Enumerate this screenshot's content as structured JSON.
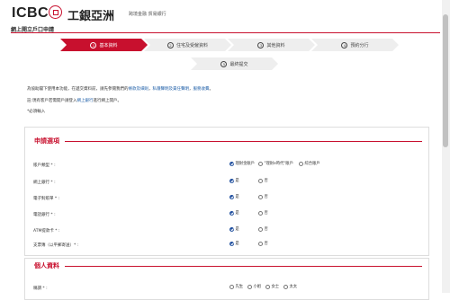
{
  "header": {
    "logo_en": "ICBC",
    "logo_cn": "工銀亞洲",
    "tagline": "跨境金融 貿易銀行"
  },
  "page_title": "網上開立戶口申請",
  "steps": [
    {
      "num": "1",
      "label": "基本資料",
      "state": "active"
    },
    {
      "num": "2",
      "label": "住宅及受僱資料",
      "state": "pending"
    },
    {
      "num": "3",
      "label": "其他資料",
      "state": "pending"
    },
    {
      "num": "4",
      "label": "預約分行",
      "state": "pending"
    },
    {
      "num": "5",
      "label": "最終提交",
      "state": "pending"
    }
  ],
  "intro": {
    "line1_prefix": "為協助閣下使用本功能，在遞交資料前，請先參閱我們的",
    "link_terms": "條款及細則",
    "sep1": "，",
    "link_privacy": "私隱聲明及責任聲明",
    "sep2": "，",
    "link_fees": "服務收費",
    "line1_suffix": "。",
    "line2_prefix": "註:現有客戶若需開戶請登入",
    "line2_link": "網上銀行",
    "line2_suffix": "進行網上開戶。",
    "required_note": "*必須輸入"
  },
  "application": {
    "section_title": "申請選項",
    "account_type": {
      "label": "賬戶類型 * :",
      "options": [
        {
          "label": "理財金賬戶",
          "selected": true
        },
        {
          "label": "\"理財e時代\"賬戶",
          "selected": false
        },
        {
          "label": "綜合賬戶",
          "selected": false
        }
      ]
    },
    "rows": [
      {
        "label": "網上銀行 * :",
        "yes": "是",
        "no": "否",
        "selected": "yes"
      },
      {
        "label": "電子對賬單 * :",
        "yes": "是",
        "no": "否",
        "selected": "yes"
      },
      {
        "label": "電話銀行 * :",
        "yes": "是",
        "no": "否",
        "selected": "yes"
      },
      {
        "label": "ATM提款卡 * :",
        "yes": "是",
        "no": "否",
        "selected": "yes"
      },
      {
        "label": "支票簿（以平郵寄送）* :",
        "yes": "是",
        "no": "否",
        "selected": "yes"
      }
    ]
  },
  "personal": {
    "section_title": "個人資料",
    "title_field": {
      "label": "稱謂 * :",
      "options": [
        "先生",
        "小姐",
        "女士",
        "太太"
      ]
    }
  },
  "colors": {
    "brand_red": "#c8102e",
    "selected_blue": "#1f4e9e",
    "link_blue": "#1f5fa8"
  }
}
